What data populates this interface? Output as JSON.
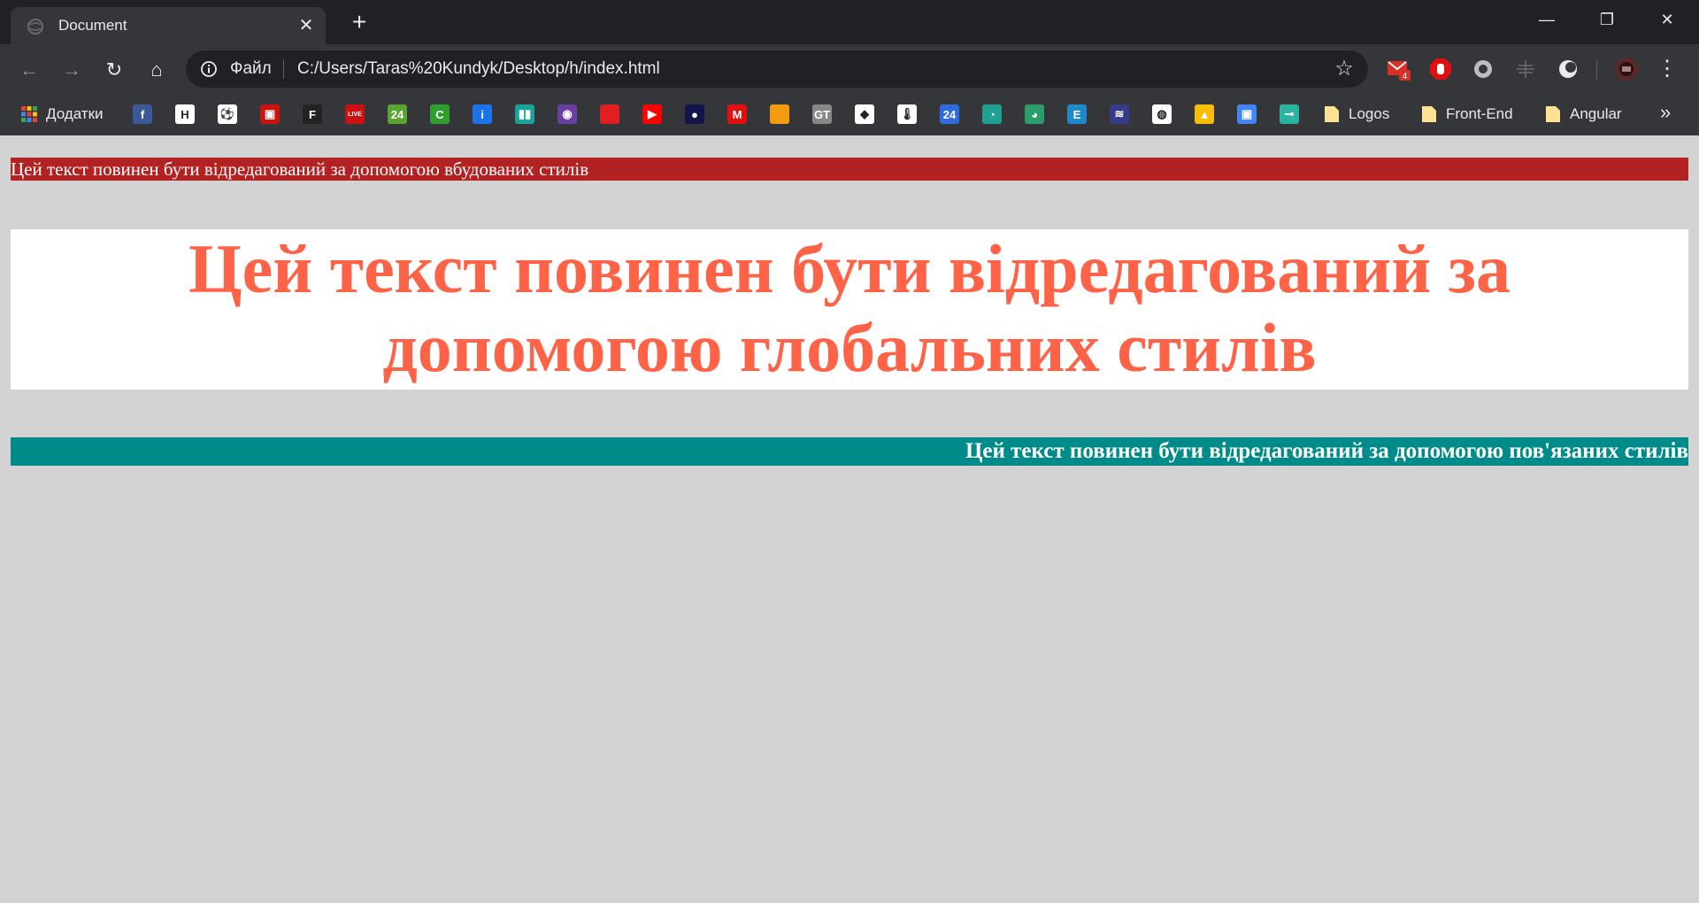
{
  "tab": {
    "title": "Document",
    "close": "✕",
    "new_tab": "+"
  },
  "window_controls": {
    "minimize": "—",
    "restore": "❐",
    "close": "✕"
  },
  "toolbar": {
    "back": "←",
    "forward": "→",
    "reload": "↻",
    "home": "⌂",
    "scheme_label": "Файл",
    "url": "C:/Users/Taras%20Kundyk/Desktop/h/index.html",
    "star": "☆",
    "gmail_badge": "4",
    "menu": "⋮"
  },
  "bookmarks": {
    "apps_label": "Додатки",
    "folders": [
      "Logos",
      "Front-End",
      "Angular"
    ],
    "overflow": "»",
    "icons": [
      {
        "name": "facebook",
        "color": "#3b5998",
        "glyph": "f"
      },
      {
        "name": "h-site",
        "color": "#ffffff",
        "glyph": "H"
      },
      {
        "name": "football",
        "color": "#ffffff",
        "glyph": "⚽"
      },
      {
        "name": "tv",
        "color": "#cc1111",
        "glyph": "▣"
      },
      {
        "name": "f1",
        "color": "#222222",
        "glyph": "F"
      },
      {
        "name": "live",
        "color": "#cc1111",
        "glyph": "LIVE"
      },
      {
        "name": "24-green",
        "color": "#5aa532",
        "glyph": "24"
      },
      {
        "name": "c-green",
        "color": "#2e9e2e",
        "glyph": "C"
      },
      {
        "name": "info",
        "color": "#1a73e8",
        "glyph": "i"
      },
      {
        "name": "bars",
        "color": "#1aa39a",
        "glyph": "▮▮"
      },
      {
        "name": "eye",
        "color": "#6a3fa0",
        "glyph": "◉"
      },
      {
        "name": "red-square",
        "color": "#e02020",
        "glyph": ""
      },
      {
        "name": "youtube",
        "color": "#ff0000",
        "glyph": "▶"
      },
      {
        "name": "dot-navy",
        "color": "#14144a",
        "glyph": "●"
      },
      {
        "name": "m-red",
        "color": "#e01010",
        "glyph": "M"
      },
      {
        "name": "orange",
        "color": "#f39c12",
        "glyph": ""
      },
      {
        "name": "gt",
        "color": "#888888",
        "glyph": "GT"
      },
      {
        "name": "mask",
        "color": "#ffffff",
        "glyph": "◆"
      },
      {
        "name": "thermometer",
        "color": "#ffffff",
        "glyph": "🌡"
      },
      {
        "name": "24-blue",
        "color": "#2d6cdf",
        "glyph": "24"
      },
      {
        "name": "circle-teal",
        "color": "#20a090",
        "glyph": "◔"
      },
      {
        "name": "circle-green",
        "color": "#2a9d6a",
        "glyph": "◕"
      },
      {
        "name": "e-blue",
        "color": "#1e88c8",
        "glyph": "E"
      },
      {
        "name": "vsp",
        "color": "#3a3a8a",
        "glyph": "≋"
      },
      {
        "name": "globe",
        "color": "#ffffff",
        "glyph": "◍"
      },
      {
        "name": "drive",
        "color": "#fbbc04",
        "glyph": "▲"
      },
      {
        "name": "contacts",
        "color": "#4285f4",
        "glyph": "▣"
      },
      {
        "name": "tool",
        "color": "#2ab3a0",
        "glyph": "⊸"
      }
    ]
  },
  "page": {
    "inline_text": "Цей текст повинен бути відредагований за допомогою вбудованих стилів",
    "global_text": "Цей текст повинен бути відредагований за допомогою глобальних стилів",
    "linked_text": "Цей текст повинен бути відредагований за допомогою пов'язаних стилів"
  },
  "colors": {
    "page_bg": "#d3d3d3",
    "inline_bg": "#b22222",
    "global_fg": "#ff6347",
    "linked_bg": "#008b8b"
  }
}
